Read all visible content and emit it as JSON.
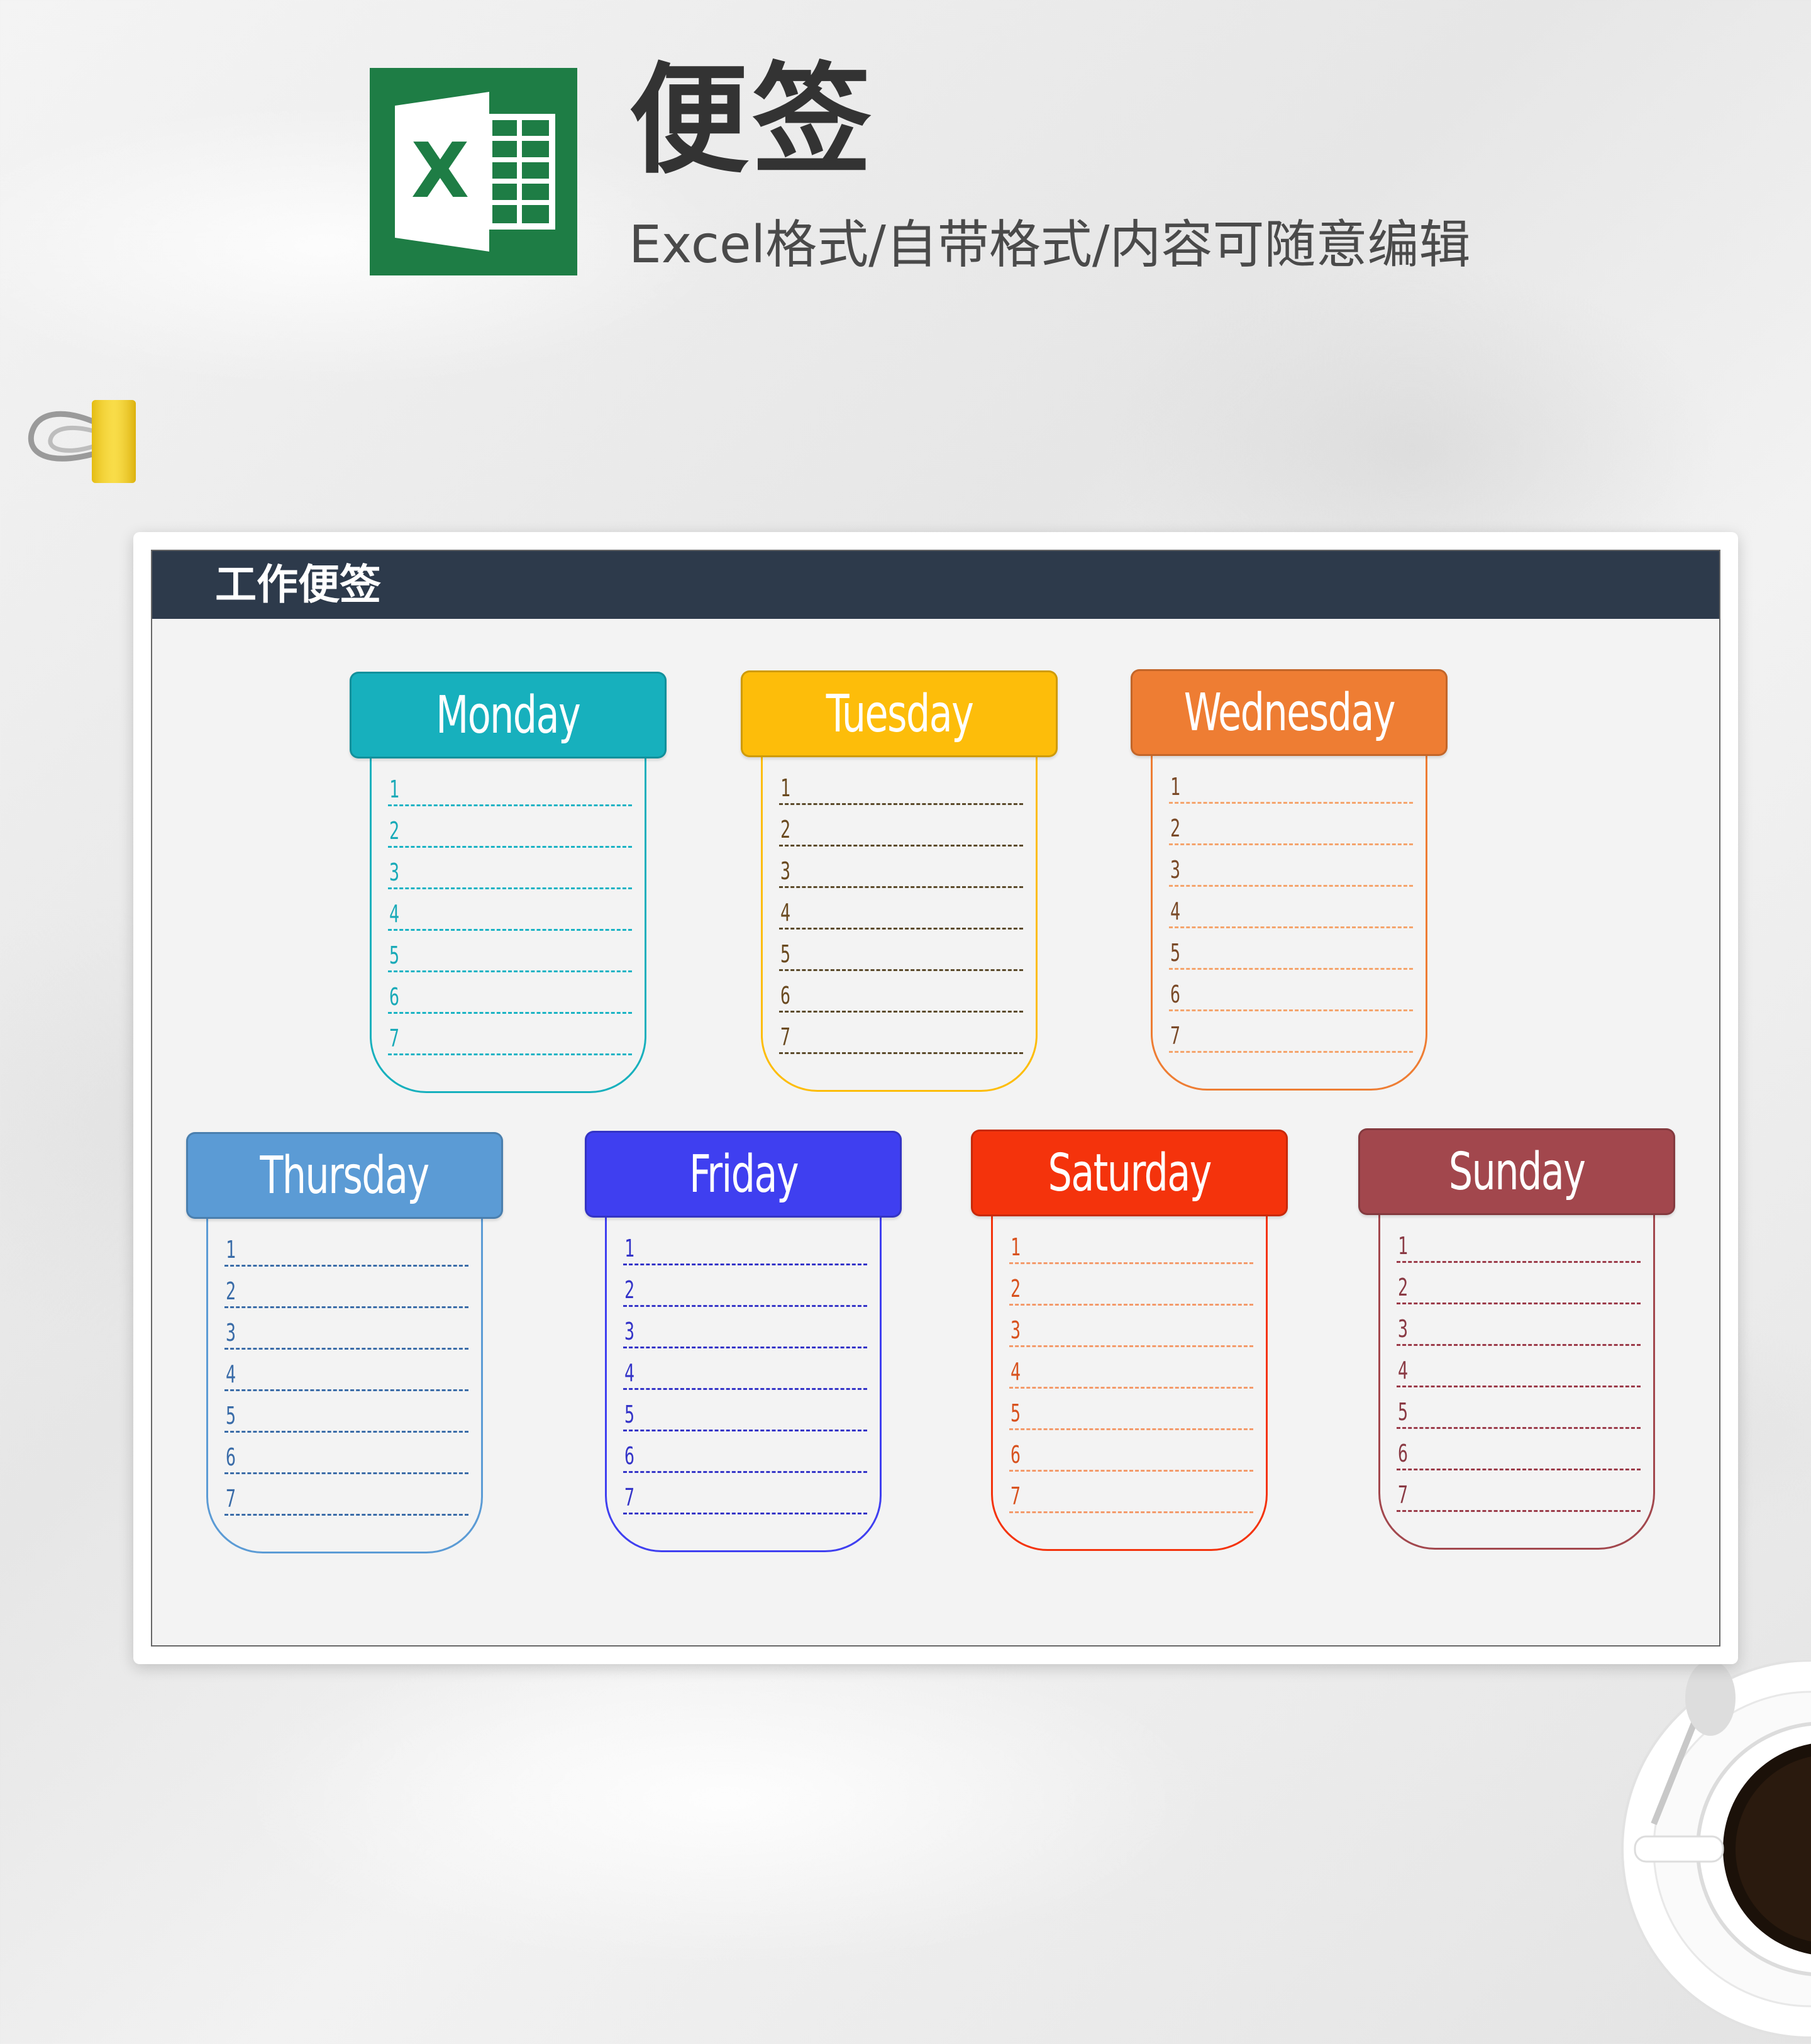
{
  "header": {
    "title": "便签",
    "subtitle": "Excel格式/自带格式/内容可随意编辑",
    "logo_letter": "X",
    "logo_color": "#1e7d45"
  },
  "sheet": {
    "title": "工作便签",
    "header_color": "#2d3a4b"
  },
  "notes": [
    {
      "day": "Monday",
      "color": "#17b0bd",
      "line_color": "#19b3c4",
      "num_color": "#19aab8",
      "numbers": [
        "1",
        "2",
        "3",
        "4",
        "5",
        "6",
        "7"
      ]
    },
    {
      "day": "Tuesday",
      "color": "#fdbd0a",
      "line_color": "#5b4a2a",
      "num_color": "#6a4a20",
      "numbers": [
        "1",
        "2",
        "3",
        "4",
        "5",
        "6",
        "7"
      ]
    },
    {
      "day": "Wednesday",
      "color": "#ee7d33",
      "line_color": "#f5a46c",
      "num_color": "#7a4a28",
      "numbers": [
        "1",
        "2",
        "3",
        "4",
        "5",
        "6",
        "7"
      ]
    },
    {
      "day": "Thursday",
      "color": "#5b9bd5",
      "line_color": "#3a6ca8",
      "num_color": "#3a6ca8",
      "numbers": [
        "1",
        "2",
        "3",
        "4",
        "5",
        "6",
        "7"
      ]
    },
    {
      "day": "Friday",
      "color": "#3f3ff0",
      "line_color": "#3434c8",
      "num_color": "#3434c8",
      "numbers": [
        "1",
        "2",
        "3",
        "4",
        "5",
        "6",
        "7"
      ]
    },
    {
      "day": "Saturday",
      "color": "#f4330c",
      "line_color": "#f49a6a",
      "num_color": "#d8521e",
      "numbers": [
        "1",
        "2",
        "3",
        "4",
        "5",
        "6",
        "7"
      ]
    },
    {
      "day": "Sunday",
      "color": "#a2474d",
      "line_color": "#9b3b49",
      "num_color": "#8a3a44",
      "numbers": [
        "1",
        "2",
        "3",
        "4",
        "5",
        "6",
        "7"
      ]
    }
  ]
}
